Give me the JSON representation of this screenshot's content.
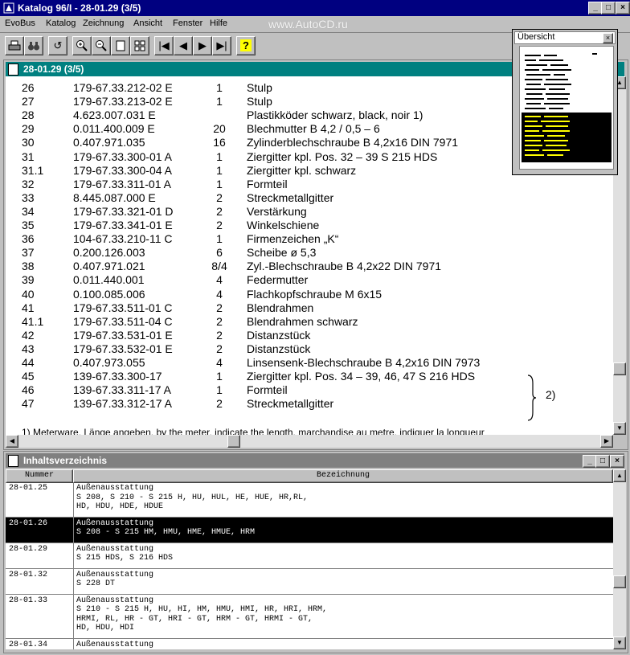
{
  "app": {
    "title": "Katalog 96/I - 28-01.29 (3/5)",
    "watermark": "www.AutoCD.ru"
  },
  "menu": [
    "EvoBus",
    "Katalog",
    "Zeichnung",
    "Ansicht",
    "Fenster",
    "Hilfe"
  ],
  "overview": {
    "title": "Übersicht"
  },
  "doc_window": {
    "title": "28-01.29 (3/5)",
    "parts": [
      {
        "pos": "26",
        "number": "179-67.33.212-02 E",
        "qty": "1",
        "desc": "Stulp"
      },
      {
        "pos": "27",
        "number": "179-67.33.213-02 E",
        "qty": "1",
        "desc": "Stulp"
      },
      {
        "pos": "28",
        "number": "4.623.007.031 E",
        "qty": "",
        "desc": "Plastikköder  schwarz, black, noir      1)"
      },
      {
        "pos": "29",
        "number": "0.011.400.009 E",
        "qty": "20",
        "desc": "Blechmutter  B 4,2 / 0,5 – 6"
      },
      {
        "pos": "30",
        "number": "0.407.971.035",
        "qty": "16",
        "desc": "Zylinderblechschraube  B 4,2x16   DIN 7971"
      },
      {
        "pos": "31",
        "number": "179-67.33.300-01 A",
        "qty": "1",
        "desc": "Ziergitter kpl. Pos. 32 – 39   S 215 HDS"
      },
      {
        "pos": "31.1",
        "number": "179-67.33.300-04 A",
        "qty": "1",
        "desc": "Ziergitter kpl. schwarz"
      },
      {
        "pos": "32",
        "number": "179-67.33.311-01 A",
        "qty": "1",
        "desc": "Formteil"
      },
      {
        "pos": "33",
        "number": "8.445.087.000 E",
        "qty": "2",
        "desc": "Streckmetallgitter"
      },
      {
        "pos": "34",
        "number": "179-67.33.321-01 D",
        "qty": "2",
        "desc": "Verstärkung"
      },
      {
        "pos": "35",
        "number": "179-67.33.341-01 E",
        "qty": "2",
        "desc": "Winkelschiene"
      },
      {
        "pos": "36",
        "number": "104-67.33.210-11 C",
        "qty": "1",
        "desc": "Firmenzeichen  „K“"
      },
      {
        "pos": "37",
        "number": "0.200.126.003",
        "qty": "6",
        "desc": "Scheibe  ø 5,3"
      },
      {
        "pos": "38",
        "number": "0.407.971.021",
        "qty": "8/4",
        "desc": "Zyl.-Blechschraube  B 4,2x22   DIN 7971"
      },
      {
        "pos": "39",
        "number": "0.011.440.001",
        "qty": "4",
        "desc": "Federmutter"
      },
      {
        "pos": "40",
        "number": "0.100.085.006",
        "qty": "4",
        "desc": "Flachkopfschraube  M 6x15"
      },
      {
        "pos": "41",
        "number": "179-67.33.511-01 C",
        "qty": "2",
        "desc": "Blendrahmen"
      },
      {
        "pos": "41.1",
        "number": "179-67.33.511-04 C",
        "qty": "2",
        "desc": "Blendrahmen  schwarz"
      },
      {
        "pos": "42",
        "number": "179-67.33.531-01 E",
        "qty": "2",
        "desc": "Distanzstück"
      },
      {
        "pos": "43",
        "number": "179-67.33.532-01 E",
        "qty": "2",
        "desc": "Distanzstück"
      },
      {
        "pos": "44",
        "number": "0.407.973.055",
        "qty": "4",
        "desc": "Linsensenk-Blechschraube   B 4,2x16       DIN 7973"
      },
      {
        "pos": "45",
        "number": "139-67.33.300-17",
        "qty": "1",
        "desc": "Ziergitter kpl.  Pos. 34 – 39, 46, 47   S 216 HDS"
      },
      {
        "pos": "46",
        "number": "139-67.33.311-17 A",
        "qty": "1",
        "desc": "Formteil"
      },
      {
        "pos": "47",
        "number": "139-67.33.312-17 A",
        "qty": "2",
        "desc": "Streckmetallgitter"
      }
    ],
    "bracket_note": "2)",
    "footnote": "1)  Meterware, Länge angeben, by the meter, indicate the length, marchandise au metre, indiquer la longueur"
  },
  "toc_window": {
    "title": "Inhaltsverzeichnis",
    "col_num": "Nummer",
    "col_desc": "Bezeichnung",
    "rows": [
      {
        "num": "28-01.25",
        "desc": "Außenausstattung\nS 208, S 210 - S 215 H, HU, HUL, HE, HUE, HR,RL,\nHD, HDU, HDE, HDUE",
        "selected": false
      },
      {
        "num": "28-01.26",
        "desc": "Außenausstattung\nS 208 - S 215 HM, HMU, HME, HMUE, HRM",
        "selected": true
      },
      {
        "num": "28-01.29",
        "desc": "Außenausstattung\nS 215 HDS, S 216 HDS",
        "selected": false
      },
      {
        "num": "28-01.32",
        "desc": "Außenausstattung\nS 228 DT",
        "selected": false
      },
      {
        "num": "28-01.33",
        "desc": "Außenausstattung\nS 210 - S 215 H, HU, HI, HM, HMU, HMI, HR, HRI, HRM,\nHRMI, RL, HR - GT, HRI - GT, HRM - GT, HRMI - GT,\nHD, HDU, HDI",
        "selected": false
      },
      {
        "num": "28-01.34",
        "desc": "Außenausstattung",
        "selected": false
      }
    ]
  },
  "colors": {
    "title_active": "#000080",
    "child_title": "#008080",
    "selection": "#000000"
  }
}
